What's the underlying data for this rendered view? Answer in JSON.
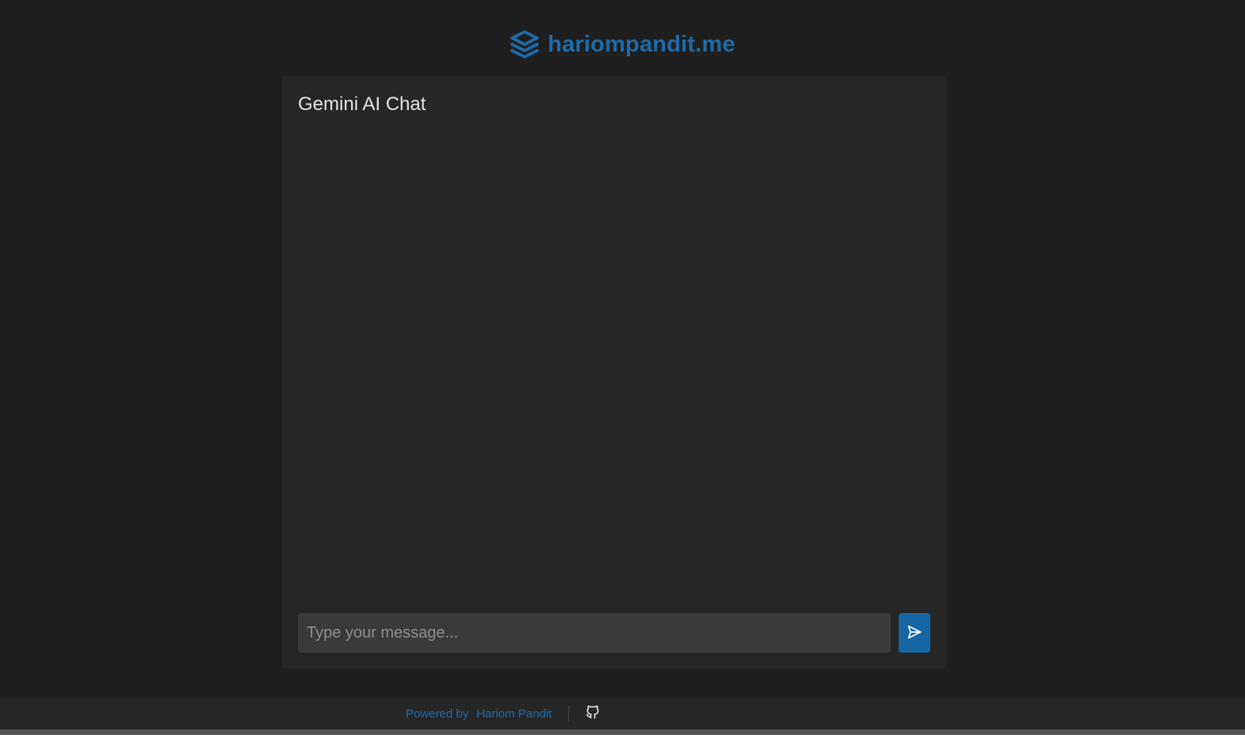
{
  "header": {
    "brand": "hariompandit.me",
    "logo_icon": "layers-icon"
  },
  "chat": {
    "title": "Gemini AI Chat",
    "messages": [],
    "input_placeholder": "Type your message...",
    "input_value": "",
    "send_icon": "send-icon"
  },
  "footer": {
    "powered_label": "Powered by",
    "author": "Hariom Pandit",
    "github_icon": "github-icon"
  },
  "colors": {
    "accent": "#1766a6",
    "background": "#1f1f1f",
    "card": "#262626",
    "input": "#3a3a3a"
  }
}
